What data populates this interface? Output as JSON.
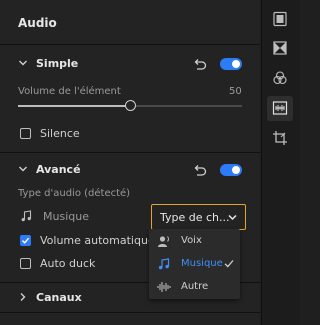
{
  "panel": {
    "title": "Audio"
  },
  "simple": {
    "header": "Simple",
    "toggle_on": true,
    "volume_label": "Volume de l'élément",
    "volume_value": "50",
    "volume_fraction": 0.5,
    "silence_label": "Silence",
    "silence_checked": false
  },
  "advanced": {
    "header": "Avancé",
    "toggle_on": true,
    "type_label": "Type d'audio (détecté)",
    "type_value": "Musique",
    "dropdown_value": "Type de ch...",
    "auto_volume_label": "Volume automatique",
    "auto_volume_checked": true,
    "auto_duck_label": "Auto duck",
    "auto_duck_checked": false
  },
  "dropdown_menu": {
    "items": [
      {
        "label": "Voix",
        "icon": "voice-icon",
        "selected": false
      },
      {
        "label": "Musique",
        "icon": "music-note-icon",
        "selected": true
      },
      {
        "label": "Autre",
        "icon": "waveform-icon",
        "selected": false
      }
    ]
  },
  "channels": {
    "header": "Canaux"
  },
  "rail": {
    "icons": [
      "film-panel-icon",
      "transitions-icon",
      "color-icon",
      "audio-icon",
      "crop-icon"
    ],
    "active": "audio-icon"
  },
  "colors": {
    "accent": "#2d7bf6",
    "focus": "#e3a52a",
    "selected_text": "#3f8ff7"
  }
}
